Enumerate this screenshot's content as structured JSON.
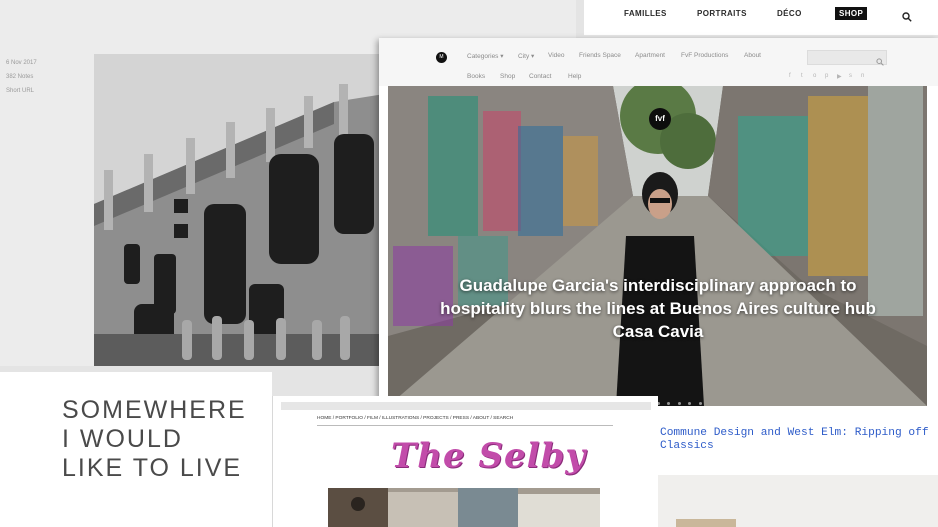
{
  "panel_a": {
    "meta": [
      "6 Nov 2017",
      "382 Notes",
      "Short URL"
    ]
  },
  "panel_b": {
    "nav": [
      "FAMILLES",
      "PORTRAITS",
      "DÉCO",
      "SHOP"
    ]
  },
  "panel_c": {
    "logo": "M",
    "menu_row1": [
      "Categories ▾",
      "City ▾",
      "Video",
      "Friends Space",
      "Apartment",
      "FvF Productions",
      "About"
    ],
    "menu_row2": [
      "Books",
      "Shop",
      "Contact",
      "Help"
    ],
    "social_icons": [
      "f",
      "t",
      "o",
      "p",
      "▶",
      "s",
      "n"
    ],
    "badge": "fvf",
    "headline": "Guadalupe Garcia's interdisciplinary approach to hospitality blurs the lines at Buenos Aires culture hub Casa Cavia",
    "slide_count": 7,
    "active_slide": 1
  },
  "panel_d": {
    "title_lines": [
      "SOMEWHERE",
      "I WOULD",
      "LIKE TO LIVE"
    ]
  },
  "panel_e": {
    "nav": "HOME / PORTFOLIO / FILM / ILLUSTRATIONS / PROJECTS / PRESS / ABOUT / SEARCH",
    "logo": "The Selby"
  },
  "panel_f": {
    "post_title": "Commune Design and West Elm: Ripping off Classics"
  },
  "colors": {
    "link_blue": "#2e5cc9",
    "selby_pink": "#c24caa",
    "shop_black": "#111111"
  }
}
